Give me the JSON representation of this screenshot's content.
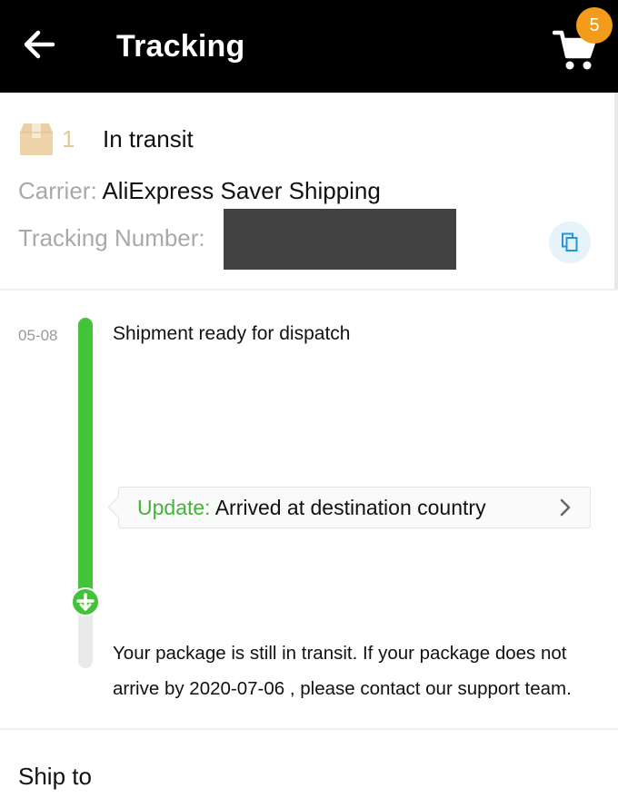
{
  "header": {
    "title": "Tracking",
    "back_icon": "arrow-left-icon",
    "cart_icon": "shopping-cart-icon",
    "cart_count": "5",
    "background": "#000000",
    "badge_color": "#f39b1b"
  },
  "package": {
    "box_icon": "package-box-icon",
    "count": "1",
    "status": "In transit",
    "carrier_label": "Carrier:",
    "carrier_value": "AliExpress Saver Shipping",
    "tracking_label": "Tracking Number:",
    "copy_icon": "copy-icon"
  },
  "timeline": {
    "date": "05-08",
    "event": "Shipment ready for dispatch",
    "progress_color": "#44c239",
    "update": {
      "prefix": "Update:",
      "text": "Arrived at destination country"
    },
    "notice": "Your package is still in transit. If your package does not arrive by 2020-07-06 , please contact our support team."
  },
  "ship_to": {
    "title": "Ship to"
  }
}
